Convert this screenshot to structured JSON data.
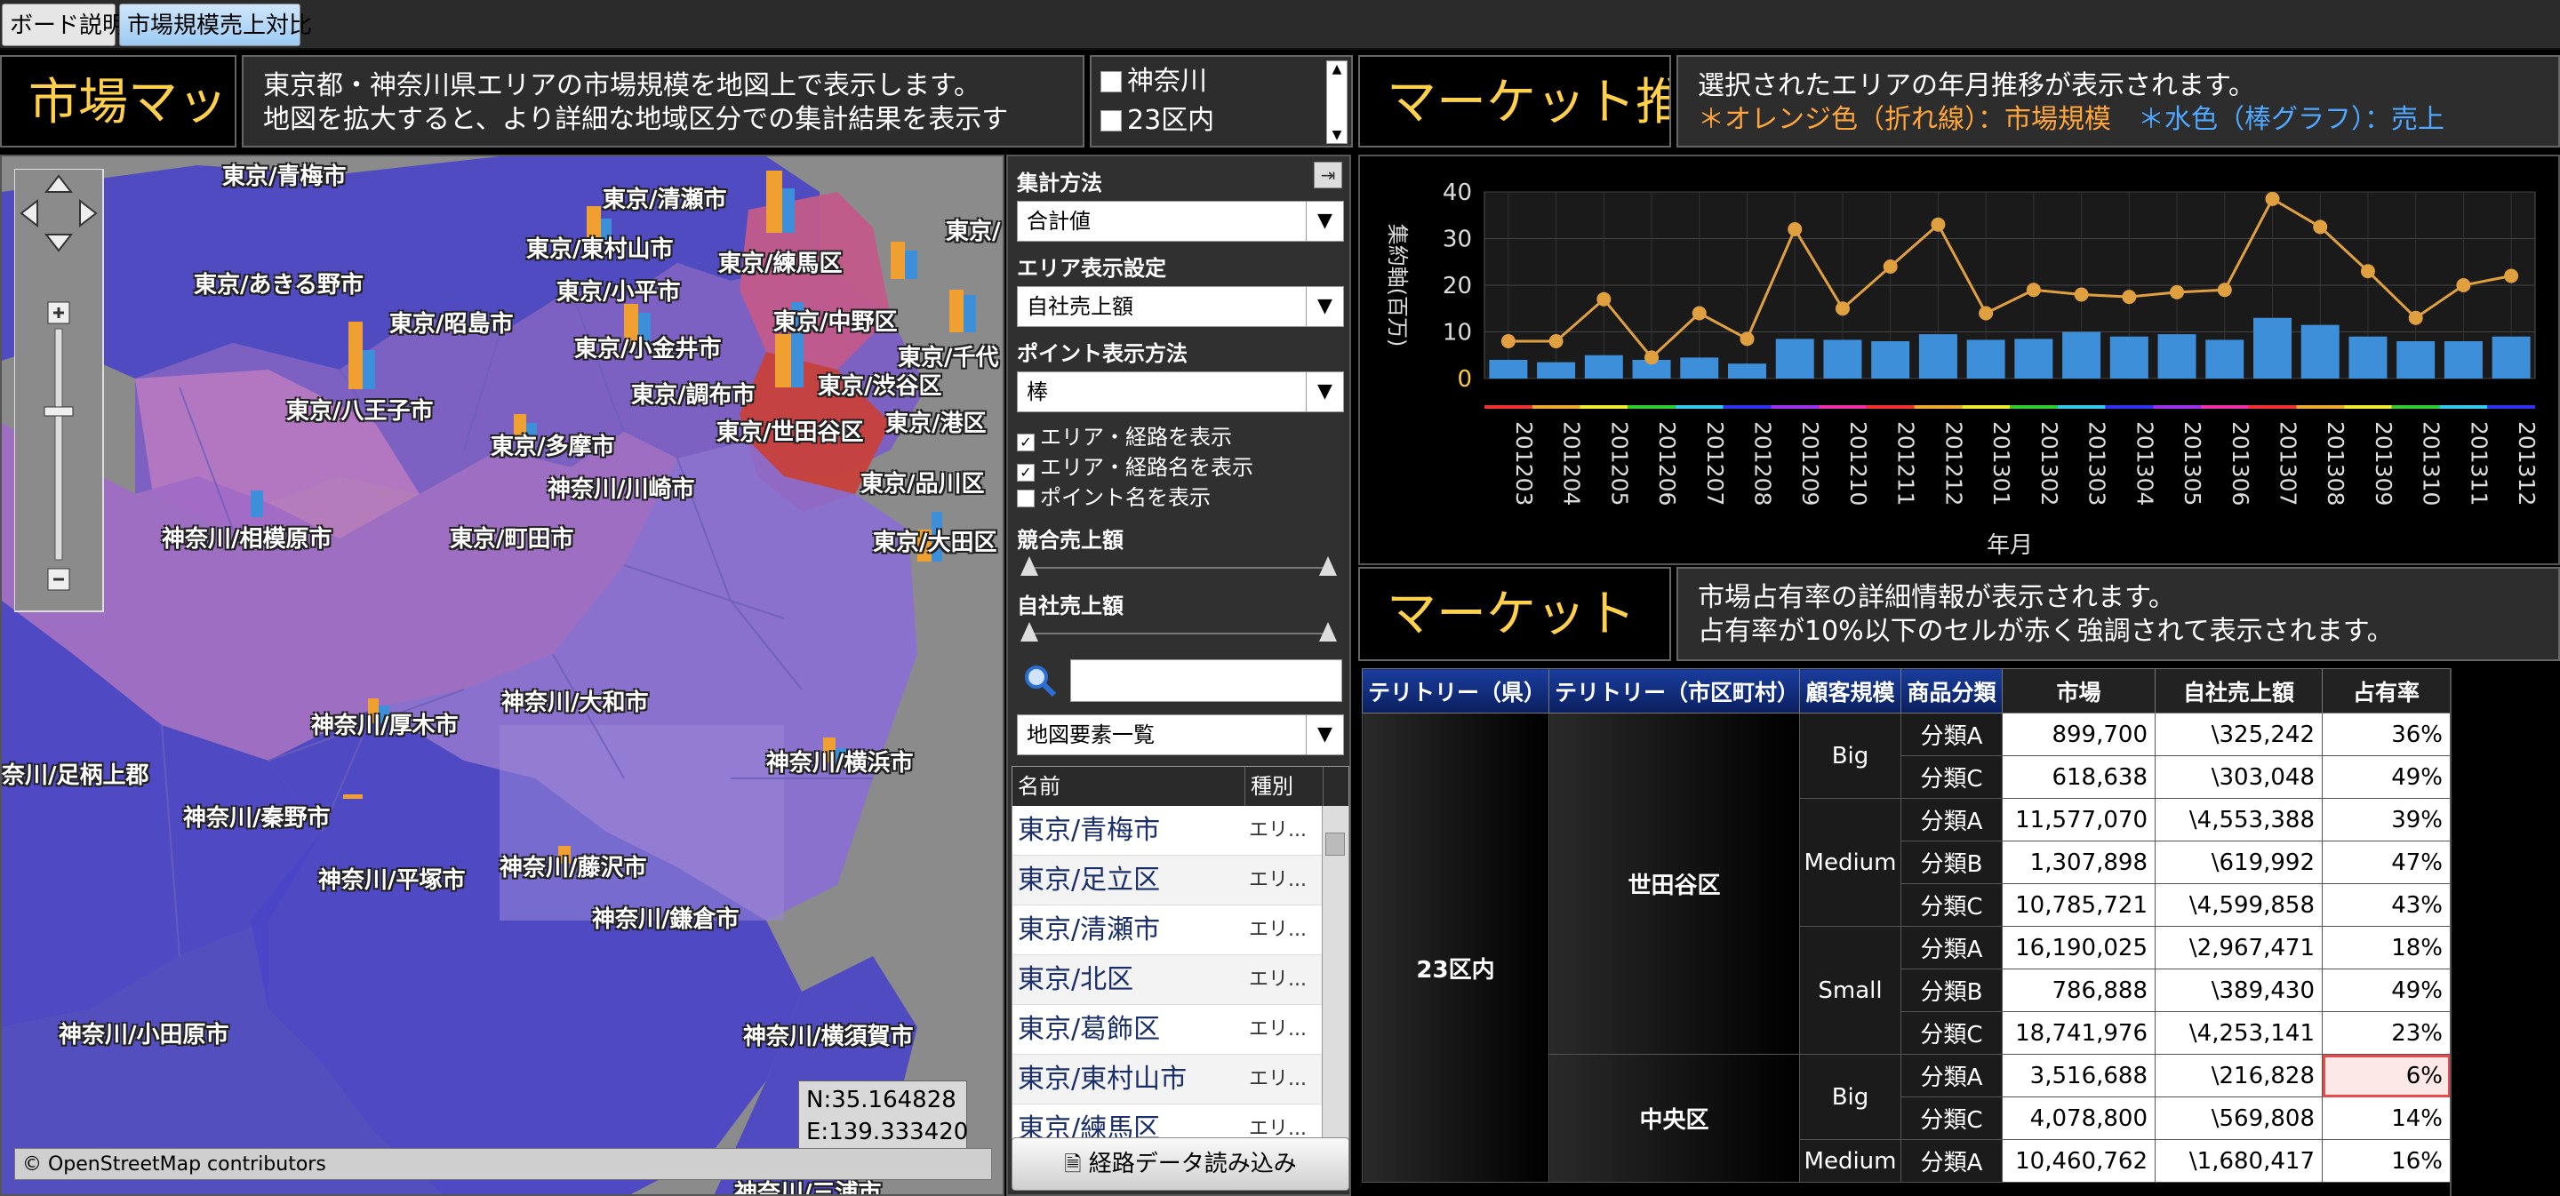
{
  "tabs": [
    "ボード説明",
    "市場規模売上対比"
  ],
  "market_map": {
    "title": "市場マッ",
    "desc_line1": "東京都・神奈川県エリアの市場規模を地図上で表示します。",
    "desc_line2": "地図を拡大すると、より詳細な地域区分での集計結果を表示す"
  },
  "area_select": {
    "items": [
      "神奈川",
      "23区内"
    ]
  },
  "market_trend": {
    "title": "マーケット推",
    "desc_line1": "選択されたエリアの年月推移が表示されます。",
    "desc_orange": "＊オレンジ色（折れ線）：市場規模",
    "desc_blue": "＊水色（棒グラフ）：売上"
  },
  "market_share": {
    "title": "マーケット",
    "desc_line1": "市場占有率の詳細情報が表示されます。",
    "desc_line2": "占有率が10%以下のセルが赤く強調されて表示されます。"
  },
  "map": {
    "labels": [
      {
        "text": "東京/青梅市"
      },
      {
        "text": "東京/清瀬市"
      },
      {
        "text": "東京/東村山市"
      },
      {
        "text": "東京/練馬区"
      },
      {
        "text": "東京/あきる野市"
      },
      {
        "text": "東京/小平市"
      },
      {
        "text": "東京/昭島市"
      },
      {
        "text": "東京/小金井市"
      },
      {
        "text": "東京/中野区"
      },
      {
        "text": "東京/千代"
      },
      {
        "text": "東京/八王子市"
      },
      {
        "text": "東京/調布市"
      },
      {
        "text": "東京/渋谷区"
      },
      {
        "text": "東京/港区"
      },
      {
        "text": "東京/多摩市"
      },
      {
        "text": "東京/世田谷区"
      },
      {
        "text": "神奈川/川崎市"
      },
      {
        "text": "東京/品川区"
      },
      {
        "text": "神奈川/相模原市"
      },
      {
        "text": "東京/町田市"
      },
      {
        "text": "東京/大田区"
      },
      {
        "text": "神奈川/大和市"
      },
      {
        "text": "神奈川/厚木市"
      },
      {
        "text": "神奈川/横浜市"
      },
      {
        "text": "奈川/足柄上郡"
      },
      {
        "text": "神奈川/秦野市"
      },
      {
        "text": "神奈川/藤沢市"
      },
      {
        "text": "神奈川/平塚市"
      },
      {
        "text": "神奈川/鎌倉市"
      },
      {
        "text": "神奈川/小田原市"
      },
      {
        "text": "神奈川/横須賀市"
      },
      {
        "text": "神奈川/三浦市"
      },
      {
        "text": "東京/"
      }
    ],
    "coord_n": "N:35.164828",
    "coord_e": "E:139.333420",
    "attribution": "© OpenStreetMap contributors"
  },
  "controls": {
    "agg_label": "集計方法",
    "agg_value": "合計値",
    "area_disp_label": "エリア表示設定",
    "area_disp_value": "自社売上額",
    "point_label": "ポイント表示方法",
    "point_value": "棒",
    "check1": "エリア・経路を表示",
    "check2": "エリア・経路名を表示",
    "check3": "ポイント名を表示",
    "slider1_label": "競合売上額",
    "slider2_label": "自社売上額",
    "map_elements": "地図要素一覧",
    "list_headers": [
      "名前",
      "種別"
    ],
    "list_rows": [
      {
        "name": "東京/青梅市",
        "kind": "エリ..."
      },
      {
        "name": "東京/足立区",
        "kind": "エリ..."
      },
      {
        "name": "東京/清瀬市",
        "kind": "エリ..."
      },
      {
        "name": "東京/北区",
        "kind": "エリ..."
      },
      {
        "name": "東京/葛飾区",
        "kind": "エリ..."
      },
      {
        "name": "東京/東村山市",
        "kind": "エリ..."
      },
      {
        "name": "東京/練馬区",
        "kind": "エリ..."
      }
    ],
    "route_button": "経路データ読み込み"
  },
  "chart_data": {
    "type": "bar+line",
    "categories": [
      "201203",
      "201204",
      "201205",
      "201206",
      "201207",
      "201208",
      "201209",
      "201210",
      "201211",
      "201212",
      "201301",
      "201302",
      "201303",
      "201304",
      "201305",
      "201306",
      "201307",
      "201308",
      "201309",
      "201310",
      "201311",
      "201312"
    ],
    "series": [
      {
        "type": "bar",
        "values": [
          4,
          3.5,
          5,
          4,
          4.5,
          3.2,
          8.5,
          8.3,
          8,
          9.5,
          8.3,
          8.5,
          10,
          9,
          9.5,
          8.3,
          13,
          11.5,
          9,
          8,
          8,
          9
        ]
      },
      {
        "type": "line",
        "values": [
          8,
          8,
          17,
          4.5,
          14,
          8.5,
          32,
          15,
          24,
          33,
          14,
          19,
          18,
          17.5,
          18.5,
          19,
          38.5,
          32.5,
          23,
          13,
          20,
          22
        ]
      }
    ],
    "ylabel": "集約軸(百万)",
    "xlabel": "年月",
    "ylim": [
      0,
      40
    ],
    "yticks": [
      "0",
      "10",
      "20",
      "30",
      "40"
    ],
    "colors": {
      "bar": "#3d8fd9",
      "line": "#e0a040"
    }
  },
  "table": {
    "headers": [
      "テリトリー（県）",
      "テリトリー（市区町村）",
      "顧客規模",
      "商品分類",
      "市場",
      "自社売上額",
      "占有率"
    ],
    "pref": "23区内",
    "groups": [
      {
        "city": "世田谷区",
        "sizes": [
          {
            "size": "Big",
            "rows": [
              [
                "分類A",
                "899,700",
                "\\325,242",
                "36%"
              ],
              [
                "分類C",
                "618,638",
                "\\303,048",
                "49%"
              ]
            ]
          },
          {
            "size": "Medium",
            "rows": [
              [
                "分類A",
                "11,577,070",
                "\\4,553,388",
                "39%"
              ],
              [
                "分類B",
                "1,307,898",
                "\\619,992",
                "47%"
              ],
              [
                "分類C",
                "10,785,721",
                "\\4,599,858",
                "43%"
              ]
            ]
          },
          {
            "size": "Small",
            "rows": [
              [
                "分類A",
                "16,190,025",
                "\\2,967,471",
                "18%"
              ],
              [
                "分類B",
                "786,888",
                "\\389,430",
                "49%"
              ],
              [
                "分類C",
                "18,741,976",
                "\\4,253,141",
                "23%"
              ]
            ]
          }
        ]
      },
      {
        "city": "中央区",
        "sizes": [
          {
            "size": "Big",
            "rows": [
              [
                "分類A",
                "3,516,688",
                "\\216,828",
                "6%"
              ],
              [
                "分類C",
                "4,078,800",
                "\\569,808",
                "14%"
              ]
            ]
          },
          {
            "size": "Medium",
            "rows": [
              [
                "分類A",
                "10,460,762",
                "\\1,680,417",
                "16%"
              ]
            ]
          }
        ]
      }
    ]
  }
}
